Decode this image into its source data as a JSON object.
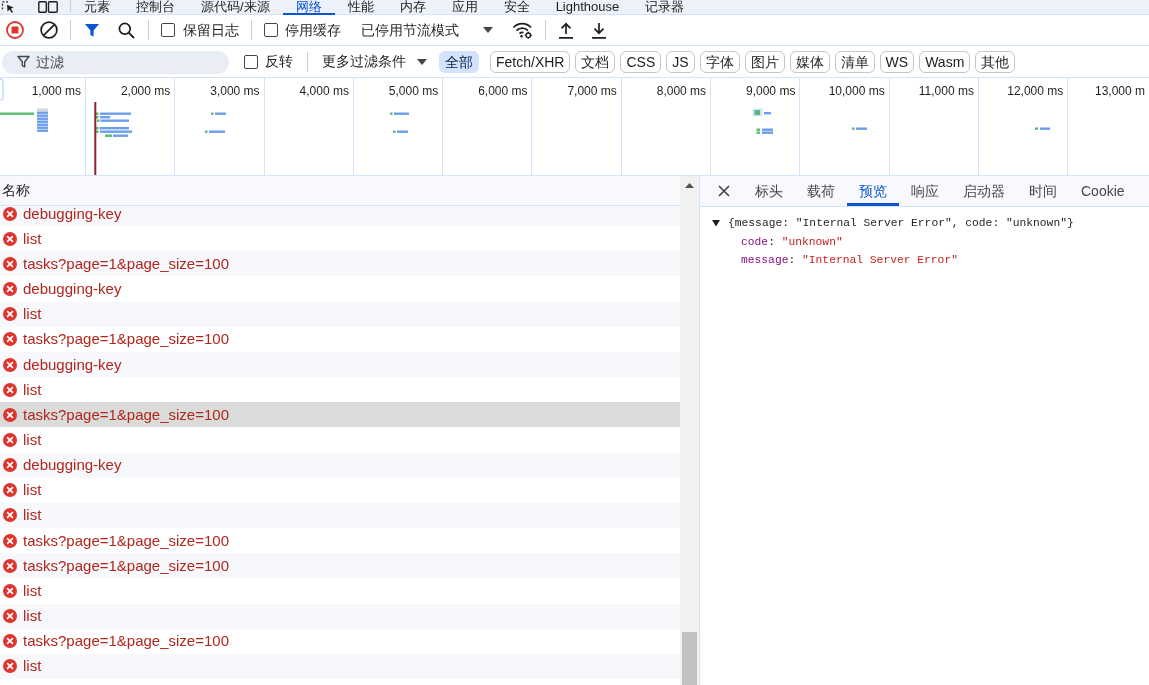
{
  "devtools_tabs": [
    {
      "label": "元素",
      "selected": false
    },
    {
      "label": "控制台",
      "selected": false
    },
    {
      "label": "源代码/来源",
      "selected": false
    },
    {
      "label": "网络",
      "selected": true
    },
    {
      "label": "性能",
      "selected": false
    },
    {
      "label": "内存",
      "selected": false
    },
    {
      "label": "应用",
      "selected": false
    },
    {
      "label": "安全",
      "selected": false
    },
    {
      "label": "Lighthouse",
      "selected": false
    },
    {
      "label": "记录器",
      "selected": false
    }
  ],
  "network_toolbar": {
    "recording": true,
    "filter_bar_shown": true,
    "preserve_log": {
      "label": "保留日志",
      "checked": false
    },
    "disable_cache": {
      "label": "停用缓存",
      "checked": false
    },
    "throttling": {
      "value": "已停用节流模式"
    }
  },
  "filter_bar": {
    "filter": {
      "placeholder": "过滤"
    },
    "invert": {
      "label": "反转",
      "checked": false
    },
    "more_filters": {
      "label": "更多过滤条件"
    },
    "types": [
      {
        "label": "全部",
        "selected": true
      },
      {
        "label": "Fetch/XHR",
        "selected": false
      },
      {
        "label": "文档",
        "selected": false
      },
      {
        "label": "CSS",
        "selected": false
      },
      {
        "label": "JS",
        "selected": false
      },
      {
        "label": "字体",
        "selected": false
      },
      {
        "label": "图片",
        "selected": false
      },
      {
        "label": "媒体",
        "selected": false
      },
      {
        "label": "清单",
        "selected": false
      },
      {
        "label": "WS",
        "selected": false
      },
      {
        "label": "Wasm",
        "selected": false
      },
      {
        "label": "其他",
        "selected": false
      }
    ]
  },
  "overview": {
    "ticks": [
      "1,000 ms",
      "2,000 ms",
      "3,000 ms",
      "4,000 ms",
      "5,000 ms",
      "6,000 ms",
      "7,000 ms",
      "8,000 ms",
      "9,000 ms",
      "10,000 ms",
      "11,000 ms",
      "12,000 ms",
      "13,000 m"
    ]
  },
  "requests": {
    "column": "名称",
    "rows": [
      {
        "name": "debugging-key",
        "failed": true,
        "selected": false
      },
      {
        "name": "list",
        "failed": true,
        "selected": false
      },
      {
        "name": "tasks?page=1&page_size=100",
        "failed": true,
        "selected": false
      },
      {
        "name": "debugging-key",
        "failed": true,
        "selected": false
      },
      {
        "name": "list",
        "failed": true,
        "selected": false
      },
      {
        "name": "tasks?page=1&page_size=100",
        "failed": true,
        "selected": false
      },
      {
        "name": "debugging-key",
        "failed": true,
        "selected": false
      },
      {
        "name": "list",
        "failed": true,
        "selected": false
      },
      {
        "name": "tasks?page=1&page_size=100",
        "failed": true,
        "selected": true
      },
      {
        "name": "list",
        "failed": true,
        "selected": false
      },
      {
        "name": "debugging-key",
        "failed": true,
        "selected": false
      },
      {
        "name": "list",
        "failed": true,
        "selected": false
      },
      {
        "name": "list",
        "failed": true,
        "selected": false
      },
      {
        "name": "tasks?page=1&page_size=100",
        "failed": true,
        "selected": false
      },
      {
        "name": "tasks?page=1&page_size=100",
        "failed": true,
        "selected": false
      },
      {
        "name": "list",
        "failed": true,
        "selected": false
      },
      {
        "name": "list",
        "failed": true,
        "selected": false
      },
      {
        "name": "tasks?page=1&page_size=100",
        "failed": true,
        "selected": false
      },
      {
        "name": "list",
        "failed": true,
        "selected": false
      }
    ]
  },
  "details": {
    "tabs": [
      {
        "label": "标头",
        "selected": false
      },
      {
        "label": "载荷",
        "selected": false
      },
      {
        "label": "预览",
        "selected": true
      },
      {
        "label": "响应",
        "selected": false
      },
      {
        "label": "启动器",
        "selected": false
      },
      {
        "label": "时间",
        "selected": false
      },
      {
        "label": "Cookie",
        "selected": false
      }
    ],
    "preview": {
      "expanded": true,
      "summary": "{message: \"Internal Server Error\", code: \"unknown\"}",
      "properties": [
        {
          "key": "code",
          "separator": ": ",
          "value": "\"unknown\""
        },
        {
          "key": "message",
          "separator": ": ",
          "value": "\"Internal Server Error\""
        }
      ]
    }
  }
}
